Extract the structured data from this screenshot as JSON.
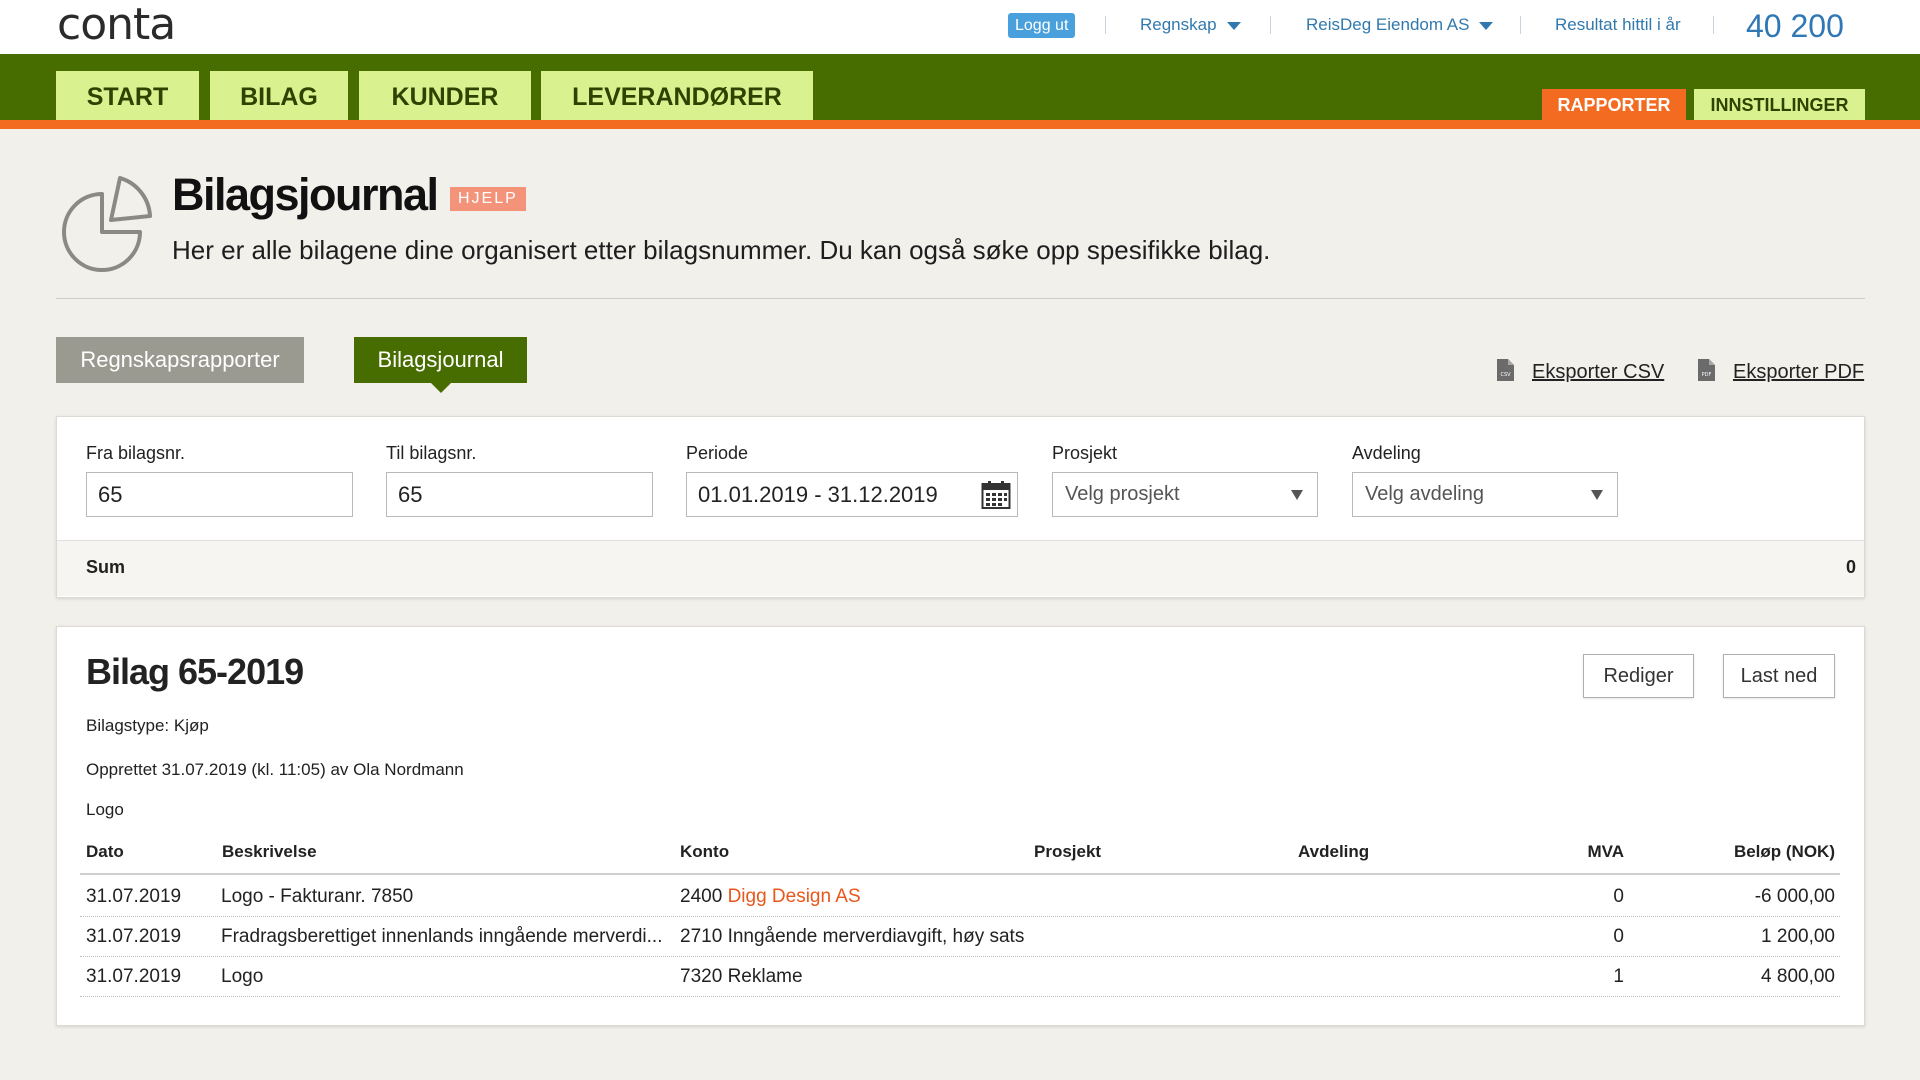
{
  "topbar": {
    "logo_text": "conta",
    "logout_label": "Logg ut",
    "menu_regnskap": "Regnskap",
    "company": "ReisDeg Eiendom AS",
    "result_label": "Resultat hittil i år",
    "result_value": "40 200"
  },
  "nav": {
    "tabs": [
      "START",
      "BILAG",
      "KUNDER",
      "LEVERANDØRER"
    ],
    "reports_label": "RAPPORTER",
    "settings_label": "INNSTILLINGER"
  },
  "colors": {
    "nav_green": "#476c00",
    "tab_light_green": "#d9f28f",
    "accent_orange": "#f26b21",
    "link_blue": "#3179ad"
  },
  "header": {
    "icon": "pie-chart-icon",
    "title": "Bilagsjournal",
    "help_label": "HJELP",
    "subtitle": "Her er alle bilagene dine organisert etter bilagsnummer. Du kan også søke opp spesifikke bilag."
  },
  "report_tabs": {
    "regnskap": "Regnskapsrapporter",
    "journal": "Bilagsjournal",
    "export_csv": "Eksporter CSV",
    "export_pdf": "Eksporter PDF"
  },
  "filters": {
    "from_label": "Fra bilagsnr.",
    "from_value": "65",
    "to_label": "Til bilagsnr.",
    "to_value": "65",
    "period_label": "Periode",
    "period_value": "01.01.2019 - 31.12.2019",
    "project_label": "Prosjekt",
    "project_value": "Velg prosjekt",
    "department_label": "Avdeling",
    "department_value": "Velg avdeling",
    "sum_label": "Sum",
    "sum_value": "0"
  },
  "voucher": {
    "title": "Bilag 65-2019",
    "edit_label": "Rediger",
    "download_label": "Last ned",
    "type_line": "Bilagstype: Kjøp",
    "created_line": "Opprettet 31.07.2019 (kl. 11:05) av Ola Nordmann",
    "description": "Logo",
    "columns": [
      "Dato",
      "Beskrivelse",
      "Konto",
      "Prosjekt",
      "Avdeling",
      "MVA",
      "Beløp (NOK)"
    ],
    "rows": [
      {
        "date": "31.07.2019",
        "desc": "Logo - Fakturanr. 7850",
        "account_no": "2400",
        "account_name": "Digg Design AS",
        "project": "",
        "department": "",
        "mva": "0",
        "amount": "-6 000,00"
      },
      {
        "date": "31.07.2019",
        "desc": "Fradragsberettiget innenlands inngående merverdi...",
        "account_no": "2710",
        "account_name": "Inngående merverdiavgift, høy sats",
        "project": "",
        "department": "",
        "mva": "0",
        "amount": "1 200,00"
      },
      {
        "date": "31.07.2019",
        "desc": "Logo",
        "account_no": "7320",
        "account_name": "Reklame",
        "project": "",
        "department": "",
        "mva": "1",
        "amount": "4 800,00"
      }
    ]
  }
}
